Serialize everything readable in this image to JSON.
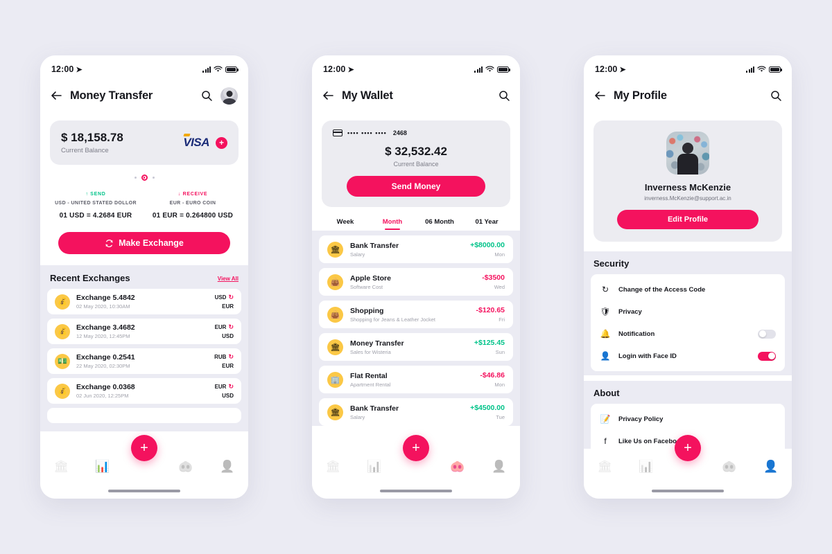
{
  "theme": {
    "accent": "#f4125e",
    "positive": "#00c389",
    "background": "#ebebf3",
    "card": "#ececf1",
    "icon_yellow": "#fbc846"
  },
  "status_bar": {
    "time": "12:00",
    "location_icon": "location-arrow-icon",
    "signal_icon": "signal-bars-icon",
    "wifi_icon": "wifi-icon",
    "battery_icon": "battery-icon"
  },
  "phone1": {
    "appbar": {
      "back_icon": "back-arrow-icon",
      "title": "Money Transfer",
      "search_icon": "search-icon",
      "avatar": "user-avatar"
    },
    "balance_card": {
      "amount": "$ 18,158.78",
      "label": "Current Balance",
      "brand": "VISA",
      "add_icon": "plus-circle-icon"
    },
    "rates": {
      "send": {
        "tag": "SEND",
        "name": "USD - UNITED STATED DOLLOR",
        "value": "01 USD = 4.2684 EUR"
      },
      "receive": {
        "tag": "RECEIVE",
        "name": "EUR - EURO COIN",
        "value": "01 EUR = 0.264800 USD"
      }
    },
    "exchange_button": {
      "label": "Make Exchange",
      "icon": "refresh-icon"
    },
    "recent": {
      "title": "Recent Exchanges",
      "view_all": "View All"
    },
    "exchanges": [
      {
        "title": "Exchange 5.4842",
        "date": "02 May 2020, 10:30AM",
        "from": "USD",
        "to": "EUR",
        "icon": "coins-icon"
      },
      {
        "title": "Exchange 3.4682",
        "date": "12 May 2020, 12:45PM",
        "from": "EUR",
        "to": "USD",
        "icon": "coins-icon"
      },
      {
        "title": "Exchange 0.2541",
        "date": "22 May 2020, 02:30PM",
        "from": "RUB",
        "to": "EUR",
        "icon": "banknote-icon"
      },
      {
        "title": "Exchange 0.0368",
        "date": "02 Jun 2020, 12:25PM",
        "from": "EUR",
        "to": "USD",
        "icon": "coins-icon"
      }
    ],
    "nav": {
      "active_index": 1,
      "items": [
        "bank-icon",
        "chart-icon",
        "wallet-icon",
        "person-icon"
      ],
      "fab": "+"
    }
  },
  "phone2": {
    "appbar": {
      "back_icon": "back-arrow-icon",
      "title": "My Wallet",
      "search_icon": "search-icon"
    },
    "wallet_card": {
      "card_icon": "credit-card-icon",
      "masked": "••••  ••••  ••••",
      "last4": "2468",
      "amount": "$ 32,532.42",
      "label": "Current Balance",
      "send_label": "Send Money"
    },
    "tabs": {
      "active_index": 1,
      "items": [
        "Week",
        "Month",
        "06 Month",
        "01 Year"
      ]
    },
    "transactions": [
      {
        "title": "Bank Transfer",
        "sub": "Salary",
        "amount": "+$8000.00",
        "day": "Mon",
        "sign": "pos",
        "icon": "bank-icon"
      },
      {
        "title": "Apple Store",
        "sub": "Software Cost",
        "amount": "-$3500",
        "day": "Wed",
        "sign": "neg",
        "icon": "bag-icon"
      },
      {
        "title": "Shopping",
        "sub": "Shopping for Jeans & Leather Jocket",
        "amount": "-$120.65",
        "day": "Fri",
        "sign": "neg",
        "icon": "bag-icon"
      },
      {
        "title": "Money Transfer",
        "sub": "Sales for Wisteria",
        "amount": "+$125.45",
        "day": "Sun",
        "sign": "pos",
        "icon": "bank-icon"
      },
      {
        "title": "Flat Rental",
        "sub": "Apartment Rental",
        "amount": "-$46.86",
        "day": "Mon",
        "sign": "neg",
        "icon": "building-icon"
      },
      {
        "title": "Bank Transfer",
        "sub": "Salary",
        "amount": "+$4500.00",
        "day": "Tue",
        "sign": "pos",
        "icon": "bank-icon"
      }
    ],
    "nav": {
      "active_index": 2,
      "items": [
        "bank-icon",
        "chart-icon",
        "wallet-icon",
        "person-icon"
      ],
      "fab": "+"
    }
  },
  "phone3": {
    "appbar": {
      "back_icon": "back-arrow-icon",
      "title": "My Profile",
      "search_icon": "search-icon"
    },
    "profile": {
      "name": "Inverness McKenzie",
      "email": "inverness.McKenzie@support.ac.in",
      "edit_label": "Edit Profile",
      "avatar": "profile-photo"
    },
    "security": {
      "title": "Security",
      "items": [
        {
          "label": "Change of the Access Code",
          "icon": "refresh-icon",
          "toggle": null
        },
        {
          "label": "Privacy",
          "icon": "shield-icon",
          "toggle": null
        },
        {
          "label": "Notification",
          "icon": "bell-icon",
          "toggle": "off"
        },
        {
          "label": "Login with Face ID",
          "icon": "face-id-icon",
          "toggle": "on"
        }
      ]
    },
    "about": {
      "title": "About",
      "items": [
        {
          "label": "Privacy Policy",
          "icon": "document-icon"
        },
        {
          "label": "Like Us on Facebook",
          "icon": "facebook-icon"
        }
      ]
    },
    "nav": {
      "active_index": 3,
      "items": [
        "bank-icon",
        "chart-icon",
        "wallet-icon",
        "person-icon"
      ],
      "fab": "+"
    }
  }
}
